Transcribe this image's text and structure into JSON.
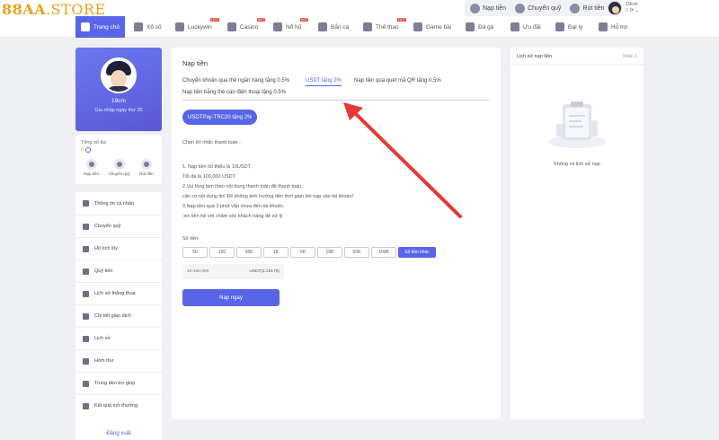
{
  "header": {
    "logo_main": "88AA",
    "logo_suffix": ".STORE",
    "actions": [
      {
        "label": "Nạp tiền",
        "icon": "deposit-icon"
      },
      {
        "label": "Chuyển quỹ",
        "icon": "transfer-icon"
      },
      {
        "label": "Rút tiền",
        "icon": "withdraw-icon"
      }
    ],
    "user": {
      "name": "19cm",
      "balance": "0"
    }
  },
  "nav": [
    {
      "label": "Trang chủ",
      "active": true
    },
    {
      "label": "Xổ số"
    },
    {
      "label": "Luckywin",
      "hot": "HOT"
    },
    {
      "label": "Casino",
      "hot": "HOT"
    },
    {
      "label": "Nổ hũ",
      "hot": "HOT"
    },
    {
      "label": "Bắn cá"
    },
    {
      "label": "Thể thao",
      "hot": "HOT"
    },
    {
      "label": "Game bài"
    },
    {
      "label": "Đá gà"
    },
    {
      "label": "Ưu đãi"
    },
    {
      "label": "Đại lý"
    },
    {
      "label": "Hỗ trợ"
    }
  ],
  "profile": {
    "name": "19cm",
    "joined": "Gia nhập ngày thứ 30"
  },
  "wallet": {
    "label": "Tổng số dư:",
    "value": "0",
    "actions": [
      "Nạp tiền",
      "Chuyển quỹ",
      "Rút tiền"
    ]
  },
  "menu": [
    "Thông tin cá nhân",
    "Chuyển quỹ",
    "Hũ tích lũy",
    "Quỹ tiền",
    "Lịch sử thắng thua",
    "Chi tiết giao dịch",
    "Lịch sử",
    "Hòm thư",
    "Trung tâm trợ giúp",
    "Kết quả mở thưởng"
  ],
  "logout": "Đăng xuất",
  "main": {
    "title": "Nạp tiền",
    "tabs": [
      "Chuyển khoản qua thẻ ngân hàng tặng 0.5%",
      "USDT tặng 2%",
      "Nạp tiền qua quét mã QR tặng 0.5%",
      "Nạp tiền bằng thẻ cào điện thoại tặng 0.5%"
    ],
    "channel": "USDTPay-TRC20 tặng 2%",
    "notes": [
      "Chọn lời nhắc thanh toán :",
      "1. Nạp tiền tối thiểu là 10USDT,",
      "Tối đa là 100,000 USDT",
      "2.Vui lòng làm theo nội dung thanh toán để thanh toán,",
      "cẩn có nội dung tin! Để không ảnh hưởng đến thời gian khi nạp  vào tài khoản!",
      "3.Nạp tiền quá 3 phút vẫn chưa đến tài khoản,",
      ":xin liên hệ với chăm sóc khách hàng để xử lý"
    ],
    "amount_label": "Số tiền:",
    "amounts": [
      "50",
      "100",
      "500",
      "1K",
      "5K",
      "10K",
      "50K",
      "100K"
    ],
    "other_amount": "Số tiền khác",
    "input_placeholder": "10-100,000",
    "input_unit": "USDT(1:26170)",
    "submit": "Nạp ngay"
  },
  "history": {
    "title": "Lịch sử nạp tiền",
    "more": "Khác >",
    "empty": "Không có lịch sử nạp"
  },
  "colors": {
    "accent": "#5865e8",
    "logo": "#e8a317",
    "arrow": "#e53935"
  }
}
